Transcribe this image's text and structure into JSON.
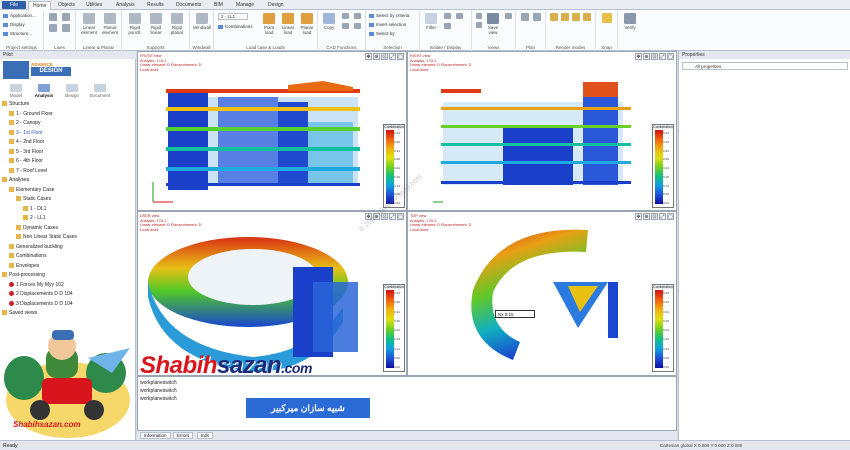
{
  "app_button": "File",
  "tabs": [
    "Home",
    "Objects",
    "Utilities",
    "Analysis",
    "Results",
    "Documents",
    "BIM",
    "Manage",
    "Design"
  ],
  "ribbon": {
    "project_settings": {
      "items": [
        "Application...",
        "Display",
        "Structure..."
      ],
      "label": "Project settings"
    },
    "lines": {
      "label": "Lines"
    },
    "linear_planar": {
      "buttons": [
        "Linear element",
        "Planar element"
      ],
      "label": "Linear & Planar"
    },
    "supports": {
      "buttons": [
        "Rigid punctl.",
        "Rigid linear",
        "Rigid planar"
      ],
      "label": "Supports"
    },
    "windwall": {
      "button": "Windwall",
      "label": "Windwall"
    },
    "load_case": {
      "case": "2 - LL1",
      "combinations": "Combinations",
      "buttons": [
        "Point load",
        "Linear load",
        "Planar load"
      ],
      "label": "Load case & Loads"
    },
    "cad": {
      "button": "Copy",
      "label": "CAD Functions"
    },
    "selection": {
      "items": [
        "Select by criteria",
        "Invert selection",
        "Select by"
      ],
      "label": "Selection"
    },
    "isolate": {
      "button": "Filter",
      "label": "Isolate / Display"
    },
    "views": {
      "buttons": [
        "Save view"
      ],
      "label": "Views"
    },
    "plan": {
      "label": "Plan"
    },
    "render": {
      "label": "Render modes"
    },
    "snap": {
      "label": "Snap"
    },
    "verify": {
      "button": "Verify"
    }
  },
  "left_panel": {
    "title": "Pilot",
    "logo_sub": "ADVANCE",
    "logo_main": "DESIGN",
    "tabs": [
      "Model",
      "Analysis",
      "Design",
      "Document"
    ],
    "tree": [
      {
        "label": "Structure",
        "level": 0
      },
      {
        "label": "1 - Ground Floor",
        "level": 1
      },
      {
        "label": "2 - Canopy",
        "level": 1
      },
      {
        "label": "3 - 1st Floor",
        "level": 1,
        "selected": true
      },
      {
        "label": "4 - 2nd Floor",
        "level": 1
      },
      {
        "label": "5 - 3rd Floor",
        "level": 1
      },
      {
        "label": "6 - 4th Floor",
        "level": 1
      },
      {
        "label": "7 - Roof Level",
        "level": 1
      },
      {
        "label": "Analyses",
        "level": 0
      },
      {
        "label": "Elementary Case",
        "level": 1
      },
      {
        "label": "Static Cases",
        "level": 2
      },
      {
        "label": "1 - DL1",
        "level": 3
      },
      {
        "label": "2 - LL1",
        "level": 3
      },
      {
        "label": "Dynamic Cases",
        "level": 2
      },
      {
        "label": "Non Linear Static Cases",
        "level": 2
      },
      {
        "label": "Generalized buckling",
        "level": 1
      },
      {
        "label": "Combinations",
        "level": 1
      },
      {
        "label": "Envelopes",
        "level": 1
      },
      {
        "label": "Post-processing",
        "level": 0
      },
      {
        "label": "1 Forces My  Myy 102",
        "level": 1,
        "red": true
      },
      {
        "label": "2 Displacements D  D  104",
        "level": 1,
        "red": true
      },
      {
        "label": "3 Displacements D  D  104",
        "level": 1,
        "red": true
      },
      {
        "label": "Saved views",
        "level": 0
      }
    ]
  },
  "viewports": [
    {
      "name": "FRONT view",
      "lines": [
        "FRONT view",
        "Analysis: 1 DL1",
        "Linear element: D  Planar element: D",
        "Local axes"
      ],
      "legend_title": "Combination"
    },
    {
      "name": "RIGHT view",
      "lines": [
        "RIGHT view",
        "Analysis: 1 DL1",
        "Linear element: D  Planar element: D",
        "Local axes"
      ],
      "legend_title": "Combination"
    },
    {
      "name": "USER view",
      "lines": [
        "USER view",
        "Analysis: 1 DL1",
        "Linear element: D  Planar element: D",
        "Local axes"
      ],
      "legend_title": "Combination"
    },
    {
      "name": "TOP view",
      "lines": [
        "TOP view",
        "Analysis: 1 DL1",
        "Linear element: D  Planar element: D",
        "Local axes"
      ],
      "legend_title": "Combination"
    }
  ],
  "legend_ticks": [
    "0.44",
    "0.39",
    "0.34",
    "0.29",
    "0.24",
    "0.19",
    "0.14",
    "0.09",
    "0.04"
  ],
  "top_tooltip": "Nx 0.15",
  "right_panel": {
    "title": "Properties",
    "select": "All properties"
  },
  "console": {
    "lines": [
      "workplaneswitch",
      "workplaneswitch",
      "workplaneswitch"
    ]
  },
  "console_tabs": [
    "Information",
    "Errors",
    "Edit"
  ],
  "status": {
    "left": "Ready",
    "right": "Cartesian global  X:0.000  Y:0.000  Z:0.000"
  },
  "watermark": {
    "brand_a": "Shabih",
    "brand_b": "sazan",
    "brand_c": ".com",
    "banner": "شبیه سازان میرکبیر",
    "site": "Shabihsazan.com",
    "copyright": "© 2020 p30download.com"
  },
  "colors": {
    "accent": "#2f5fa8",
    "brand_red": "#d8141c",
    "brand_navy": "#1b2a7a"
  }
}
